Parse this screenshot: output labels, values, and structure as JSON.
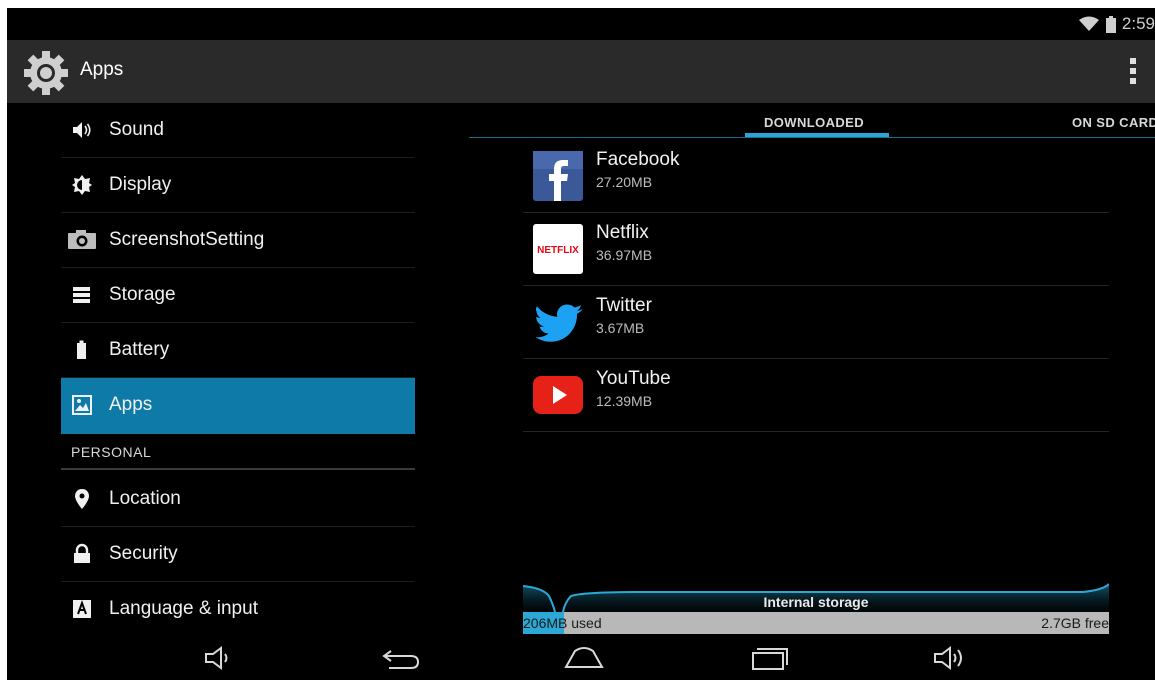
{
  "status_bar": {
    "time": "2:59",
    "wifi_icon": "wifi-icon",
    "battery_icon": "battery-icon"
  },
  "action_bar": {
    "title": "Apps",
    "icon": "settings-gear-icon",
    "overflow_icon": "overflow-menu-icon"
  },
  "sidebar": {
    "items": [
      {
        "label": "Sound",
        "icon": "volume-icon"
      },
      {
        "label": "Display",
        "icon": "brightness-icon"
      },
      {
        "label": "ScreenshotSetting",
        "icon": "camera-icon"
      },
      {
        "label": "Storage",
        "icon": "storage-icon"
      },
      {
        "label": "Battery",
        "icon": "battery-icon"
      },
      {
        "label": "Apps",
        "icon": "apps-icon",
        "selected": true
      }
    ],
    "section_header": "PERSONAL",
    "personal_items": [
      {
        "label": "Location",
        "icon": "location-pin-icon"
      },
      {
        "label": "Security",
        "icon": "lock-icon"
      },
      {
        "label": "Language & input",
        "icon": "keyboard-icon"
      }
    ]
  },
  "tabs": [
    {
      "label": "DOWNLOADED",
      "active": true
    },
    {
      "label": "ON SD CARD",
      "active": false
    }
  ],
  "apps": [
    {
      "name": "Facebook",
      "size": "27.20MB",
      "icon": "facebook-icon",
      "color": "#3b5998"
    },
    {
      "name": "Netflix",
      "size": "36.97MB",
      "icon": "netflix-icon",
      "color": "#e50914"
    },
    {
      "name": "Twitter",
      "size": "3.67MB",
      "icon": "twitter-icon",
      "color": "#1da1f2"
    },
    {
      "name": "YouTube",
      "size": "12.39MB",
      "icon": "youtube-icon",
      "color": "#e62117"
    }
  ],
  "storage": {
    "title": "Internal storage",
    "used_label": "206MB used",
    "free_label": "2.7GB free",
    "used_fraction": 0.07
  },
  "nav_bar": {
    "buttons": [
      "volume-down-icon",
      "back-icon",
      "home-icon",
      "recents-icon",
      "volume-up-icon"
    ]
  },
  "colors": {
    "accent": "#0d7aa7",
    "tab_indicator": "#2aa5d8",
    "storage_fill": "#2ca8d6"
  }
}
